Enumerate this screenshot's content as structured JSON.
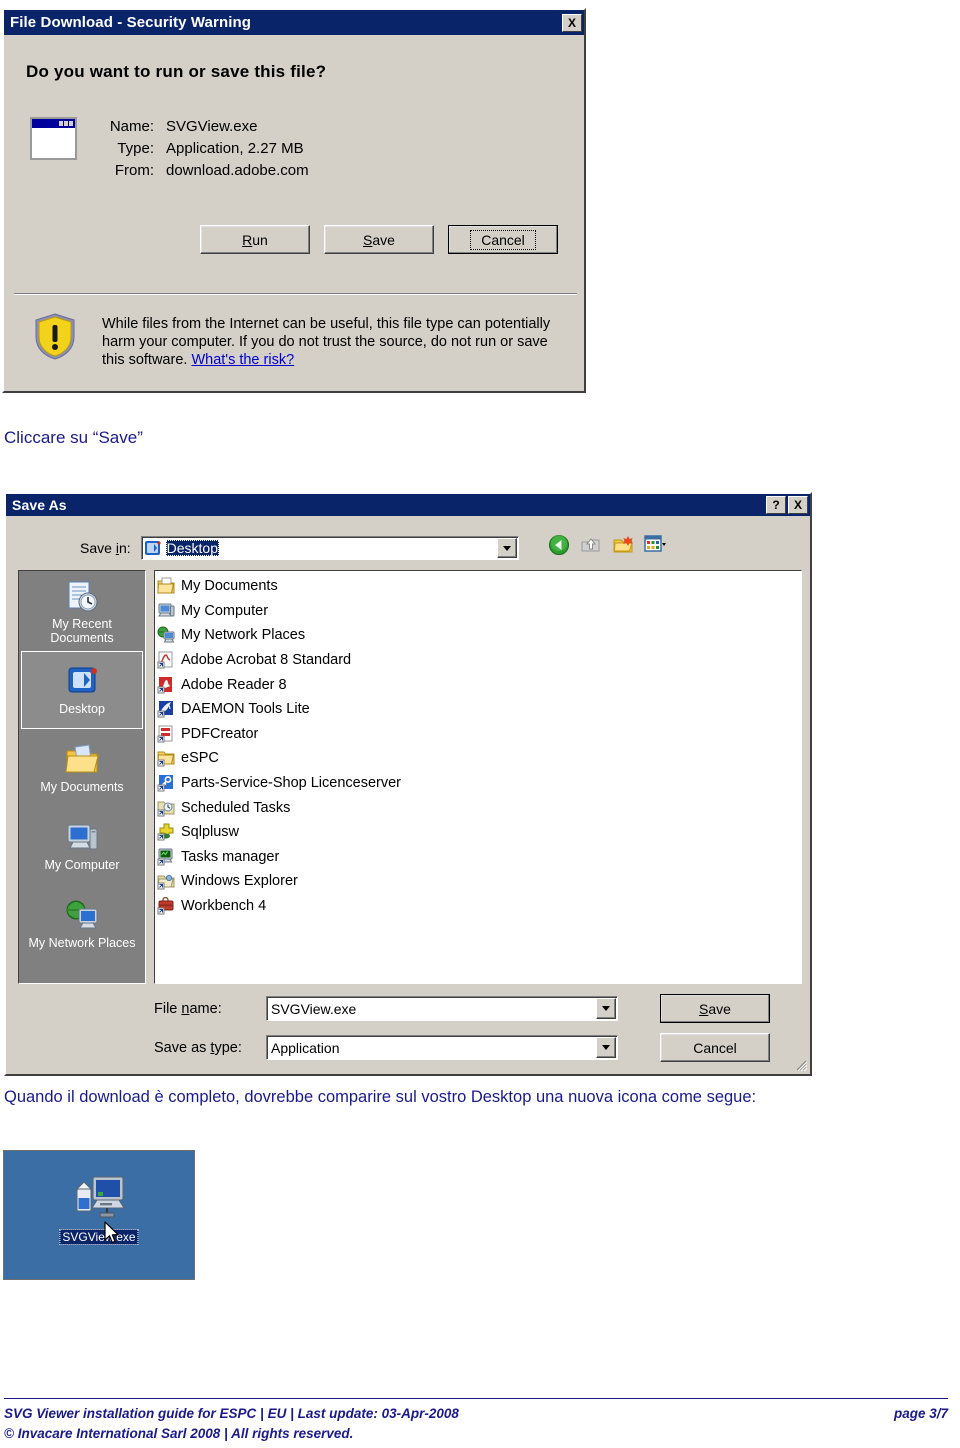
{
  "download_dialog": {
    "title": "File Download - Security Warning",
    "close_label": "X",
    "question": "Do you want to run or save this file?",
    "fields": [
      {
        "label": "Name:",
        "value": "SVGView.exe"
      },
      {
        "label": "Type:",
        "value": "Application, 2.27 MB"
      },
      {
        "label": "From:",
        "value": "download.adobe.com"
      }
    ],
    "buttons": {
      "run": "Run",
      "save": "Save",
      "cancel": "Cancel"
    },
    "warning_text": "While files from the Internet can be useful, this file type can potentially harm your computer. If you do not trust the source, do not run or save this software. ",
    "warning_link": "What's the risk?"
  },
  "caption_click_save": "Cliccare su “Save”",
  "saveas_dialog": {
    "title": "Save As",
    "help_label": "?",
    "close_label": "X",
    "save_in_label": "Save in:",
    "save_in_value": "Desktop",
    "toolbar_icons": [
      "back-icon",
      "up-one-level-icon",
      "create-new-folder-icon",
      "views-icon"
    ],
    "places": [
      {
        "label": "My Recent Documents",
        "icon": "recent-documents-icon",
        "selected": false
      },
      {
        "label": "Desktop",
        "icon": "desktop-icon",
        "selected": true
      },
      {
        "label": "My Documents",
        "icon": "my-documents-icon",
        "selected": false
      },
      {
        "label": "My Computer",
        "icon": "my-computer-icon",
        "selected": false
      },
      {
        "label": "My Network Places",
        "icon": "my-network-places-icon",
        "selected": false
      }
    ],
    "files": [
      {
        "name": "My Documents",
        "icon": "folder-documents-icon"
      },
      {
        "name": "My Computer",
        "icon": "my-computer-icon"
      },
      {
        "name": "My Network Places",
        "icon": "my-network-places-icon"
      },
      {
        "name": "Adobe Acrobat 8 Standard",
        "icon": "acrobat-shortcut-icon"
      },
      {
        "name": "Adobe Reader 8",
        "icon": "adobe-reader-shortcut-icon"
      },
      {
        "name": "DAEMON Tools Lite",
        "icon": "daemon-tools-shortcut-icon"
      },
      {
        "name": "PDFCreator",
        "icon": "pdfcreator-shortcut-icon"
      },
      {
        "name": "eSPC",
        "icon": "folder-shortcut-icon"
      },
      {
        "name": "Parts-Service-Shop Licenceserver",
        "icon": "key-shortcut-icon"
      },
      {
        "name": "Scheduled Tasks",
        "icon": "scheduled-tasks-shortcut-icon"
      },
      {
        "name": "Sqlplusw",
        "icon": "sqlplus-shortcut-icon"
      },
      {
        "name": "Tasks manager",
        "icon": "tasks-manager-shortcut-icon"
      },
      {
        "name": "Windows Explorer",
        "icon": "windows-explorer-shortcut-icon"
      },
      {
        "name": "Workbench 4",
        "icon": "workbench-shortcut-icon"
      }
    ],
    "file_name_label": "File name:",
    "file_name_value": "SVGView.exe",
    "save_as_type_label": "Save as type:",
    "save_as_type_value": "Application",
    "save_button": "Save",
    "cancel_button": "Cancel"
  },
  "caption_download_complete": "Quando il download è completo, dovrebbe comparire sul vostro Desktop una nuova icona come segue:",
  "desktop_screenshot": {
    "icon_label": "SVGView.exe",
    "icon_name": "svgview-exe-desktop-icon",
    "background_color": "#3a6ea5"
  },
  "footer": {
    "left_line1": "SVG Viewer installation guide for ESPC | EU | Last update: 03-Apr-2008",
    "page": "page 3/7",
    "left_line2": "© Invacare International Sarl 2008 | All rights reserved."
  }
}
